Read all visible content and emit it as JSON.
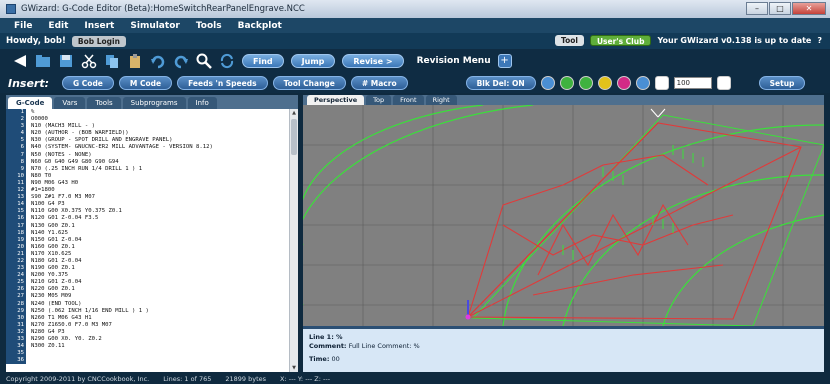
{
  "window": {
    "title": "GWizard: G-Code Editor (Beta):HomeSwitchRearPanelEngrave.NCC",
    "minimize": "–",
    "maximize": "□",
    "close": "✕"
  },
  "menu": [
    "File",
    "Edit",
    "Insert",
    "Simulator",
    "Tools",
    "Backplot"
  ],
  "status": {
    "greeting": "Howdy, bob!",
    "greeting_pill": "Bob Login",
    "tool_pill": "Tool",
    "club_pill": "User's Club",
    "update_text": "Your GWizard v0.138 is up to date",
    "help": "?"
  },
  "toolbar": {
    "find_label": "Find",
    "jump_label": "Jump",
    "revise_label": "Revise >",
    "revision_menu": "Revision Menu",
    "plus": "+"
  },
  "insert": {
    "label": "Insert:",
    "buttons": [
      "G Code",
      "M Code",
      "Feeds 'n Speeds",
      "Tool Change",
      "# Macro"
    ],
    "ok_label": "Blk Del: ON",
    "zoom_value": "100"
  },
  "left_tabs": [
    "G-Code",
    "Vars",
    "Tools",
    "Subprograms",
    "Info"
  ],
  "code_lines": [
    {
      "n": "1",
      "text": "%"
    },
    {
      "n": "2",
      "text": "O0000"
    },
    {
      "n": "3",
      "text": "N10 (MACH3 MILL - )"
    },
    {
      "n": "4",
      "text": "N20 (AUTHOR - (BOB WARFIELD))"
    },
    {
      "n": "5",
      "text": "N30 (GROUP - SPOT DRILL AND ENGRAVE PANEL)"
    },
    {
      "n": "6",
      "text": "N40 (SYSTEM- GNUCNC-ER2 MILL ADVANTAGE - VERSION 8.12)"
    },
    {
      "n": "7",
      "text": "N50 (NOTES - NONE)"
    },
    {
      "n": "8",
      "text": "N60 G0 G40 G49 G80 G90 G94"
    },
    {
      "n": "9",
      "text": "N70 (.25 INCH RUN 1/4 DRILL 1 ) 1"
    },
    {
      "n": "10",
      "text": "N80 T0"
    },
    {
      "n": "11",
      "text": "N90 M06 G43 H0"
    },
    {
      "n": "12",
      "text": "#1=1800"
    },
    {
      "n": "13",
      "text": "S90 Z#1 F7.0 M3 M07"
    },
    {
      "n": "14",
      "text": "N100 G4 P3"
    },
    {
      "n": "15",
      "text": "N110 G00 X0.375 Y0.375 Z0.1"
    },
    {
      "n": "16",
      "text": "N120 G01 Z-0.04 F3.5"
    },
    {
      "n": "17",
      "text": "N130 G00 Z0.1"
    },
    {
      "n": "18",
      "text": "N140 Y1.625"
    },
    {
      "n": "19",
      "text": "N150 G01 Z-0.04"
    },
    {
      "n": "20",
      "text": "N160 G00 Z0.1"
    },
    {
      "n": "21",
      "text": "N170 X10.625"
    },
    {
      "n": "22",
      "text": "N180 G01 Z-0.04"
    },
    {
      "n": "23",
      "text": "N190 G00 Z0.1"
    },
    {
      "n": "24",
      "text": "N200 Y0.375"
    },
    {
      "n": "25",
      "text": "N210 G01 Z-0.04"
    },
    {
      "n": "26",
      "text": "N220 G00 Z0.1"
    },
    {
      "n": "27",
      "text": "N230 M05 M09"
    },
    {
      "n": "28",
      "text": "N240 (END TOOL)"
    },
    {
      "n": "29",
      "text": "N250 (.062 INCH 1/16 END MILL ) 1 )"
    },
    {
      "n": "30",
      "text": "N260 T1 M06 G43 H1"
    },
    {
      "n": "31",
      "text": "N270 Z1650.0 F7.0 M3 M07"
    },
    {
      "n": "32",
      "text": "N280 G4 P3"
    },
    {
      "n": "33",
      "text": "N290 G00 X0. Y0. Z0.2"
    },
    {
      "n": "34",
      "text": "N300 Z0.11"
    },
    {
      "n": "35",
      "text": ""
    },
    {
      "n": "36",
      "text": ""
    }
  ],
  "right_tabs": [
    "Perspective",
    "Top",
    "Front",
    "Right"
  ],
  "info": {
    "line": "Line 1: %",
    "comment_label": "Comment:",
    "comment_value": "Full Line Comment: %",
    "time_label": "Time:",
    "time_value": "00"
  },
  "bottom": {
    "copyright": "Copyright 2009-2011 by CNCCookbook, Inc.",
    "lines": "Lines: 1 of 765",
    "bytes": "21899 bytes",
    "xyz": "X: --- Y: --- Z: ---"
  },
  "colors": {
    "toolpath": "#e03a3a",
    "grid": "#3ae03a",
    "bg": "#808080",
    "accent": "#1d4766"
  }
}
